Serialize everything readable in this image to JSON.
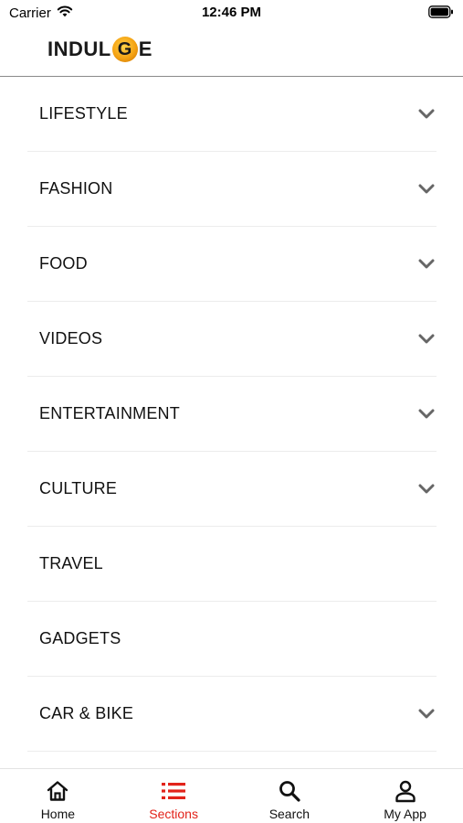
{
  "status_bar": {
    "carrier": "Carrier",
    "time": "12:46 PM"
  },
  "header": {
    "logo_text_left": "INDUL",
    "logo_text_mid": "G",
    "logo_text_right": "E"
  },
  "sections": [
    {
      "label": "LIFESTYLE",
      "expandable": true
    },
    {
      "label": "FASHION",
      "expandable": true
    },
    {
      "label": "FOOD",
      "expandable": true
    },
    {
      "label": "VIDEOS",
      "expandable": true
    },
    {
      "label": "ENTERTAINMENT",
      "expandable": true
    },
    {
      "label": "CULTURE",
      "expandable": true
    },
    {
      "label": "TRAVEL",
      "expandable": false
    },
    {
      "label": "GADGETS",
      "expandable": false
    },
    {
      "label": "CAR & BIKE",
      "expandable": true
    }
  ],
  "tab_bar": {
    "tabs": [
      {
        "label": "Home",
        "icon": "home-icon",
        "active": false
      },
      {
        "label": "Sections",
        "icon": "list-icon",
        "active": true
      },
      {
        "label": "Search",
        "icon": "search-icon",
        "active": false
      },
      {
        "label": "My App",
        "icon": "person-icon",
        "active": false
      }
    ]
  },
  "colors": {
    "accent": "#e2231a",
    "chevron": "#666666",
    "logo_gold": "#f5a313"
  }
}
